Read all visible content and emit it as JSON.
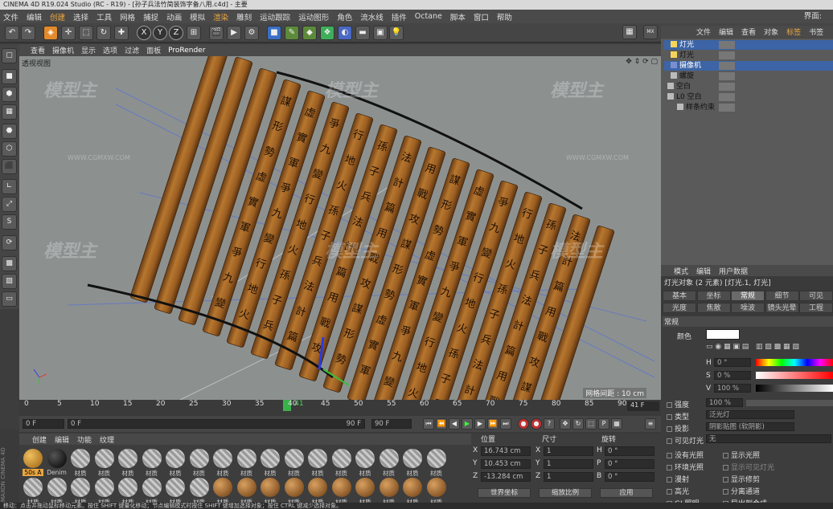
{
  "window": {
    "title": "CINEMA 4D R19.024 Studio (RC - R19) - [孙子兵法竹简装饰字备八用.c4d] - 主要"
  },
  "menu": {
    "items": [
      "文件",
      "编辑",
      "创建",
      "选择",
      "工具",
      "网格",
      "捕捉",
      "动画",
      "模拟",
      "渲染",
      "雕刻",
      "运动跟踪",
      "运动图形",
      "角色",
      "流水线",
      "插件",
      "Octane",
      "脚本",
      "窗口",
      "帮助"
    ],
    "right": "界面:"
  },
  "toolbar": {
    "axis": [
      "X",
      "Y",
      "Z"
    ]
  },
  "viewport": {
    "menu": [
      "查看",
      "摄像机",
      "显示",
      "选项",
      "过滤",
      "面板",
      "ProRender"
    ],
    "label": "透视视图",
    "grid_info": "网格间距 : 10 cm",
    "watermark": "模型主",
    "watermark_url": "WWW.CGMXW.COM"
  },
  "timeline": {
    "ticks": [
      "0",
      "5",
      "10",
      "15",
      "20",
      "25",
      "30",
      "35",
      "40",
      "41",
      "45",
      "50",
      "55",
      "60",
      "65",
      "70",
      "75",
      "80",
      "85",
      "90"
    ],
    "current": "41 F",
    "start": "0 F",
    "min": "0 F",
    "max": "90 F",
    "end": "90 F"
  },
  "materials": {
    "menu": [
      "创建",
      "编辑",
      "功能",
      "纹理"
    ],
    "row1": [
      "50s A",
      "Denim",
      "材质",
      "材质",
      "材质",
      "材质",
      "材质",
      "材质",
      "材质",
      "材质",
      "材质",
      "材质",
      "材质",
      "材质",
      "材质",
      "材质",
      "材质",
      "材质"
    ],
    "row2": [
      "材质",
      "材质",
      "材质",
      "材质",
      "材质",
      "材质",
      "材质",
      "材质",
      "材质",
      "材质",
      "材质",
      "材质",
      "材质",
      "材质",
      "材质",
      "材质",
      "材质",
      "材质"
    ]
  },
  "coords": {
    "headers": [
      "位置",
      "尺寸",
      "旋转"
    ],
    "rows": [
      {
        "a": "X",
        "pos": "16.743 cm",
        "b": "X",
        "size": "1",
        "c": "H",
        "rot": "0 °"
      },
      {
        "a": "Y",
        "pos": "10.453 cm",
        "b": "Y",
        "size": "1",
        "c": "P",
        "rot": "0 °"
      },
      {
        "a": "Z",
        "pos": "-13.284 cm",
        "b": "Z",
        "size": "1",
        "c": "B",
        "rot": "0 °"
      }
    ],
    "mode1": "世界坐标",
    "mode2": "缩放比例",
    "apply": "应用"
  },
  "objects": {
    "menu": [
      "文件",
      "编辑",
      "查看",
      "对象",
      "标签",
      "书签"
    ],
    "items": [
      "灯光",
      "灯光",
      "摄像机",
      "螺旋",
      "空白",
      "L0 空白",
      "样条约束"
    ]
  },
  "attributes": {
    "menu": [
      "模式",
      "编辑",
      "用户数据"
    ],
    "title": "灯光对象 (2 元素) [灯光.1, 灯光]",
    "tabs_row1": [
      "基本",
      "坐标",
      "常规",
      "细节",
      "可见"
    ],
    "tabs_row2": [
      "光度",
      "焦散",
      "噪波",
      "镜头光晕",
      "工程"
    ],
    "section": "常规",
    "color_label": "颜色",
    "h_label": "H",
    "s_label": "S",
    "v_label": "V",
    "h_val": "0 °",
    "s_val": "0 %",
    "v_val": "100 %",
    "intensity_label": "强度",
    "intensity_val": "100 %",
    "type_label": "类型",
    "type_val": "泛光灯",
    "shadow_label": "投影",
    "shadow_val": "阴影贴图 (软阴影)",
    "vislight_label": "可见灯光",
    "vislight_val": "无",
    "noillum": "没有光照",
    "showillum": "显示光照",
    "ambient": "环境光照",
    "showvis": "显示可见灯光",
    "diffuse": "漫射",
    "showclip": "显示修剪",
    "specular": "高光",
    "separate": "分离通道",
    "gi": "GI 照明",
    "export": "导出到合成"
  },
  "status": "移动：点击并拖动鼠标移动元素。按住 SHIFT 键量化移动；节点编辑模式时按住 SHIFT 键增加选择对象；按住 CTRL 键减少选择对象。"
}
